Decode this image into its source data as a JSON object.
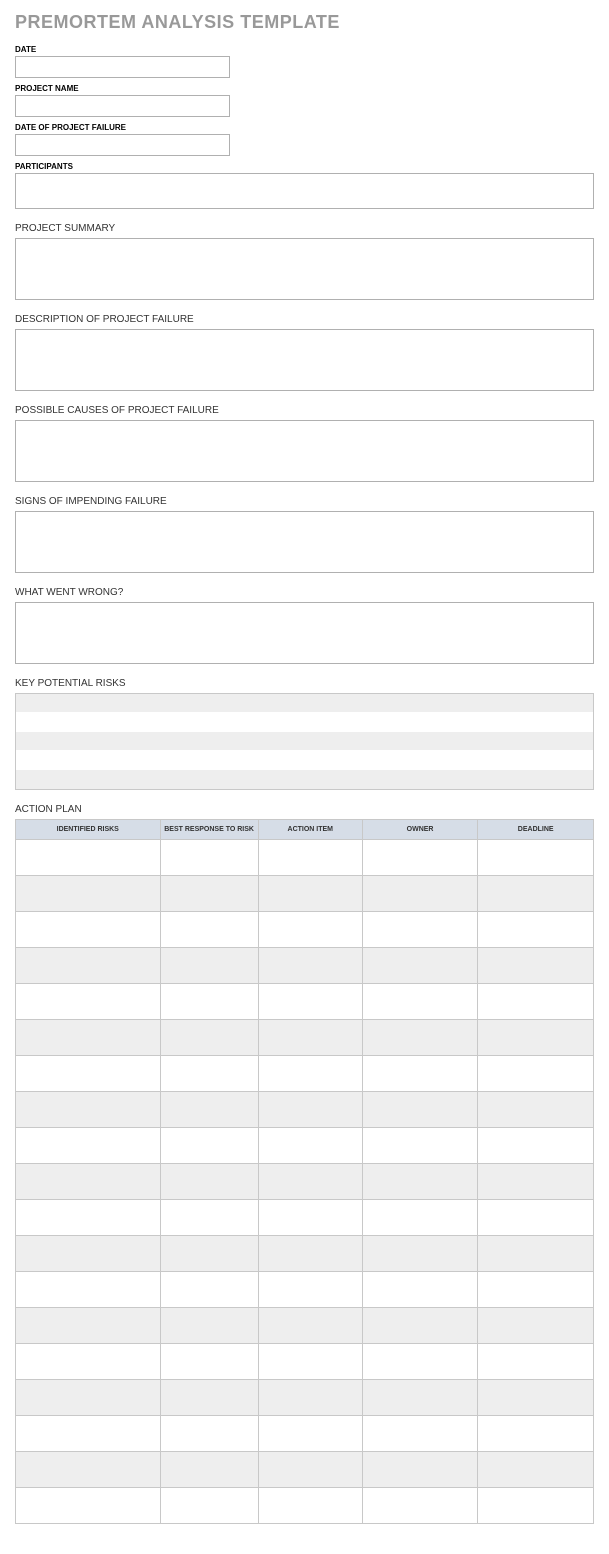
{
  "title": "PREMORTEM ANALYSIS TEMPLATE",
  "fields": {
    "date": {
      "label": "DATE",
      "value": ""
    },
    "project_name": {
      "label": "PROJECT NAME",
      "value": ""
    },
    "date_failure": {
      "label": "DATE OF PROJECT FAILURE",
      "value": ""
    },
    "participants": {
      "label": "PARTICIPANTS",
      "value": ""
    }
  },
  "sections": {
    "summary": {
      "label": "PROJECT SUMMARY",
      "value": ""
    },
    "description": {
      "label": "DESCRIPTION OF PROJECT FAILURE",
      "value": ""
    },
    "causes": {
      "label": "POSSIBLE CAUSES OF PROJECT FAILURE",
      "value": ""
    },
    "signs": {
      "label": "SIGNS OF IMPENDING FAILURE",
      "value": ""
    },
    "wrong": {
      "label": "WHAT WENT WRONG?",
      "value": ""
    },
    "risks": {
      "label": "KEY POTENTIAL RISKS",
      "rows": [
        "",
        "",
        "",
        "",
        ""
      ]
    },
    "plan": {
      "label": "ACTION PLAN",
      "headers": [
        "IDENTIFIED RISKS",
        "BEST RESPONSE TO RISK",
        "ACTION ITEM",
        "OWNER",
        "DEADLINE"
      ],
      "row_count": 19
    }
  }
}
